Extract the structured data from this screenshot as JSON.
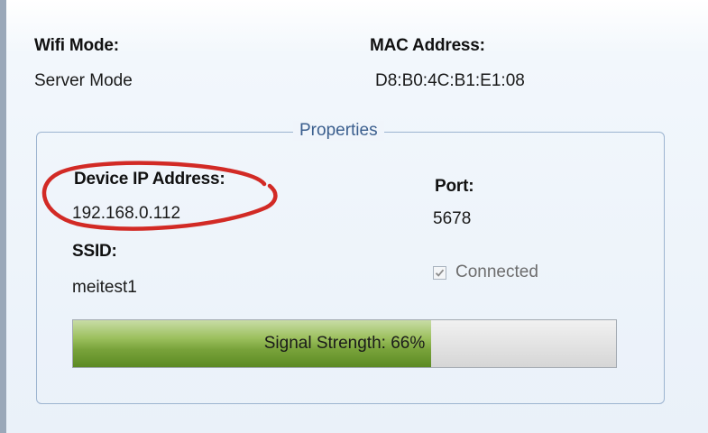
{
  "wifi_mode": {
    "label": "Wifi Mode:",
    "value": "Server Mode"
  },
  "mac_address": {
    "label": "MAC Address:",
    "value": "D8:B0:4C:B1:E1:08"
  },
  "properties": {
    "title": "Properties",
    "device_ip": {
      "label": "Device IP Address:",
      "value": "192.168.0.112"
    },
    "port": {
      "label": "Port:",
      "value": "5678"
    },
    "ssid": {
      "label": "SSID:",
      "value": "meitest1"
    },
    "connected": {
      "label": "Connected",
      "checked": true
    },
    "signal_strength": {
      "text": "Signal Strength: 66%",
      "percent": 66
    }
  },
  "colors": {
    "annotation_ellipse": "#d22a25",
    "progress_fill": "#79a33b",
    "group_border": "#9cb4d0",
    "group_title": "#3b5f8e"
  },
  "icons": {
    "connected_check": "checkmark-icon"
  }
}
